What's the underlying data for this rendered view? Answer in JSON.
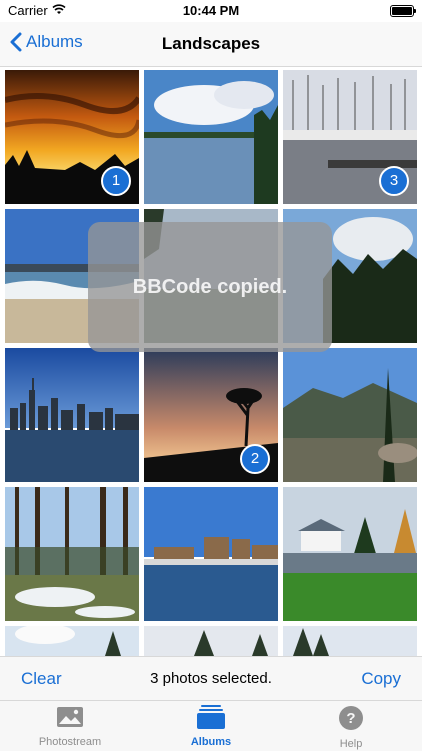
{
  "status_bar": {
    "carrier": "Carrier",
    "time": "10:44 PM"
  },
  "nav": {
    "back_label": "Albums",
    "title": "Landscapes"
  },
  "selection_badges": [
    "1",
    "2",
    "3"
  ],
  "toast": {
    "message": "BBCode copied."
  },
  "toolbar": {
    "clear_label": "Clear",
    "status": "3 photos selected.",
    "copy_label": "Copy"
  },
  "tabs": [
    {
      "label": "Photostream",
      "icon": "photo-icon",
      "active": false
    },
    {
      "label": "Albums",
      "icon": "albums-icon",
      "active": true
    },
    {
      "label": "Help",
      "icon": "help-icon",
      "active": false
    }
  ],
  "colors": {
    "accent": "#1a6fd4",
    "toast": "#969696",
    "bar_bg": "#f7f7f7"
  }
}
